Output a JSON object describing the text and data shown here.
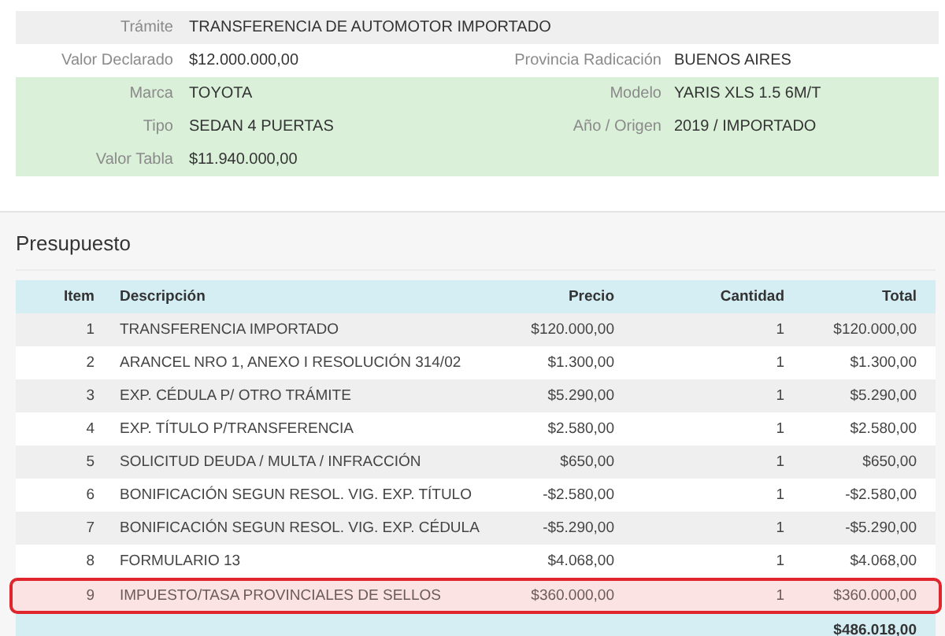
{
  "details": [
    {
      "kind": "header",
      "fields": [
        {
          "label": "Trámite",
          "value": "TRANSFERENCIA DE AUTOMOTOR IMPORTADO"
        }
      ]
    },
    {
      "kind": "plain",
      "fields": [
        {
          "label": "Valor Declarado",
          "value": "$12.000.000,00"
        },
        {
          "label": "Provincia Radicación",
          "value": "BUENOS AIRES"
        }
      ]
    },
    {
      "kind": "vehicle",
      "fields": [
        {
          "label": "Marca",
          "value": "TOYOTA"
        },
        {
          "label": "Modelo",
          "value": "YARIS XLS 1.5 6M/T"
        }
      ]
    },
    {
      "kind": "vehicle",
      "fields": [
        {
          "label": "Tipo",
          "value": "SEDAN 4 PUERTAS"
        },
        {
          "label": "Año / Origen",
          "value": "2019 / IMPORTADO"
        }
      ]
    },
    {
      "kind": "vehicle",
      "fields": [
        {
          "label": "Valor Tabla",
          "value": "$11.940.000,00"
        }
      ]
    }
  ],
  "budget": {
    "title": "Presupuesto",
    "columns": [
      "Item",
      "Descripción",
      "Precio",
      "Cantidad",
      "Total"
    ],
    "rows": [
      {
        "item": "1",
        "description": "TRANSFERENCIA IMPORTADO",
        "price": "$120.000,00",
        "quantity": "1",
        "total": "$120.000,00",
        "highlighted": false
      },
      {
        "item": "2",
        "description": "ARANCEL NRO 1, ANEXO I RESOLUCIÓN 314/02",
        "price": "$1.300,00",
        "quantity": "1",
        "total": "$1.300,00",
        "highlighted": false
      },
      {
        "item": "3",
        "description": "EXP. CÉDULA P/ OTRO TRÁMITE",
        "price": "$5.290,00",
        "quantity": "1",
        "total": "$5.290,00",
        "highlighted": false
      },
      {
        "item": "4",
        "description": "EXP. TÍTULO P/TRANSFERENCIA",
        "price": "$2.580,00",
        "quantity": "1",
        "total": "$2.580,00",
        "highlighted": false
      },
      {
        "item": "5",
        "description": "SOLICITUD DEUDA / MULTA / INFRACCIÓN",
        "price": "$650,00",
        "quantity": "1",
        "total": "$650,00",
        "highlighted": false
      },
      {
        "item": "6",
        "description": "BONIFICACIÓN SEGUN RESOL. VIG. EXP. TÍTULO",
        "price": "-$2.580,00",
        "quantity": "1",
        "total": "-$2.580,00",
        "highlighted": false
      },
      {
        "item": "7",
        "description": "BONIFICACIÓN SEGUN RESOL. VIG. EXP. CÉDULA",
        "price": "-$5.290,00",
        "quantity": "1",
        "total": "-$5.290,00",
        "highlighted": false
      },
      {
        "item": "8",
        "description": "FORMULARIO 13",
        "price": "$4.068,00",
        "quantity": "1",
        "total": "$4.068,00",
        "highlighted": false
      },
      {
        "item": "9",
        "description": "IMPUESTO/TASA PROVINCIALES DE SELLOS",
        "price": "$360.000,00",
        "quantity": "1",
        "total": "$360.000,00",
        "highlighted": true
      }
    ],
    "grand_total": "$486.018,00"
  }
}
